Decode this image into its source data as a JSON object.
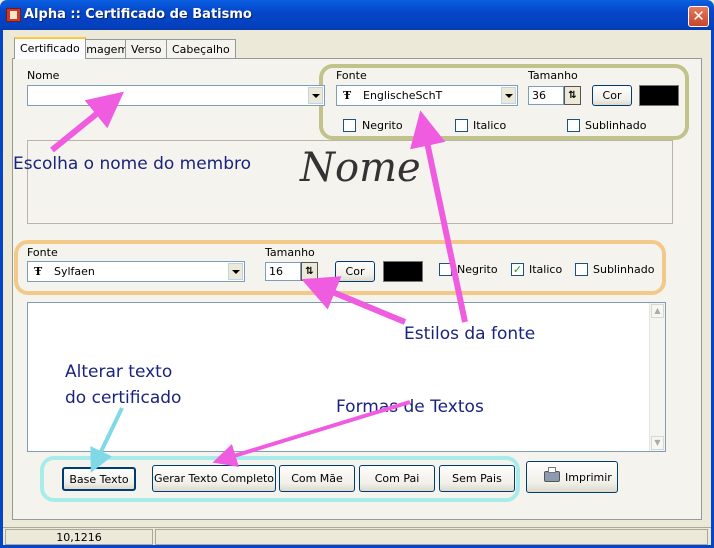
{
  "window": {
    "title": "Alpha :: Certificado de Batismo",
    "close_glyph": "✕"
  },
  "tabs": [
    {
      "label": "Certificado",
      "active": true
    },
    {
      "label": "Imagem"
    },
    {
      "label": "Verso"
    },
    {
      "label": "Cabeçalho"
    }
  ],
  "name_section": {
    "nome_label": "Nome",
    "nome_value": "",
    "preview_text": "Nome",
    "fonte_label": "Fonte",
    "fonte_value": "EnglischeSchT",
    "tamanho_label": "Tamanho",
    "tamanho_value": "36",
    "cor_label": "Cor",
    "color": "#000000",
    "negrito_label": "Negrito",
    "negrito_checked": false,
    "italico_label": "Italico",
    "italico_checked": false,
    "sublinhado_label": "Sublinhado",
    "sublinhado_checked": false
  },
  "text_section": {
    "fonte_label": "Fonte",
    "fonte_value": "Sylfaen",
    "tamanho_label": "Tamanho",
    "tamanho_value": "16",
    "cor_label": "Cor",
    "color": "#000000",
    "negrito_label": "Negrito",
    "negrito_checked": false,
    "italico_label": "Italico",
    "italico_checked": true,
    "sublinhado_label": "Sublinhado",
    "sublinhado_checked": false,
    "body_text": ""
  },
  "buttons": {
    "base_texto": "Base Texto",
    "gerar_texto_completo": "Gerar Texto Completo",
    "com_mae": "Com Mãe",
    "com_pai": "Com Pai",
    "sem_pais": "Sem Pais",
    "imprimir": "Imprimir"
  },
  "annotations": {
    "escolha_nome": "Escolha o nome do membro",
    "estilos_fonte": "Estilos da fonte",
    "alterar_texto_1": "Alterar texto",
    "alterar_texto_2": "do certificado",
    "formas_textos": "Formas de Textos"
  },
  "colors": {
    "highlight_name_group": "#c2c38a",
    "highlight_text_group": "#f3c98a",
    "highlight_buttons": "#a8ecea",
    "arrow_magenta": "#f05ce0",
    "arrow_cyan": "#7fd9e6",
    "annotation_text": "#1a237e"
  },
  "status": {
    "cell1": "10,1216",
    "cell2": ""
  }
}
